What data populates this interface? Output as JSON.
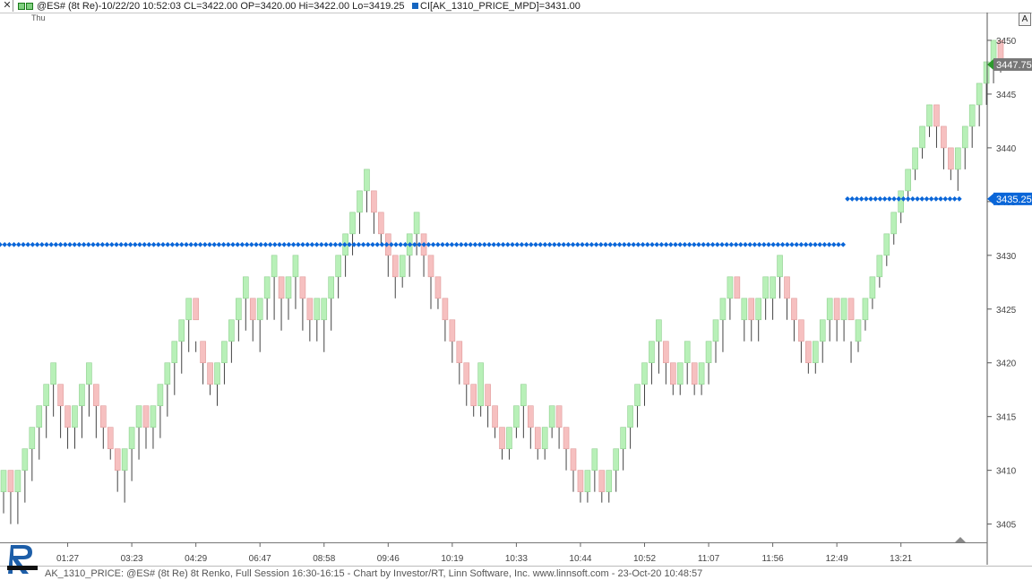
{
  "header": {
    "close_icon": "close-icon",
    "symbol_title": "@ES# (8t Re)-10/22/20 10:52:03 CL=3422.00 OP=3420.00 Hi=3422.00 Lo=3419.25",
    "indicator_title": "CI[AK_1310_PRICE_MPD]=3431.00",
    "indicator_color": "#1565c0",
    "day_label": "Thu",
    "autoscale_button": "A"
  },
  "footer": {
    "text": "AK_1310_PRICE: @ES# (8t Re) 8t Renko, Full Session 16:30-16:15 - Chart by Investor/RT, Linn Software, Inc. www.linnsoft.com - 23-Oct-20 10:48:57"
  },
  "colors": {
    "up": "#b8f0b8",
    "down": "#f6c0c0",
    "wick": "#444444",
    "indicator": "#0a66d8",
    "last_price_bg": "#777777"
  },
  "chart_data": {
    "type": "candlestick",
    "bar_type": "8t Renko",
    "y_ticks": [
      3405,
      3410,
      3415,
      3420,
      3425,
      3430,
      3435,
      3440,
      3445,
      3450
    ],
    "ylim": [
      3403.3,
      3452.5
    ],
    "x_ticks": [
      "01:27",
      "03:23",
      "04:29",
      "06:47",
      "08:58",
      "09:46",
      "10:19",
      "10:33",
      "10:44",
      "10:52",
      "11:07",
      "11:56",
      "12:49",
      "13:21"
    ],
    "last_price_label": "3447.75",
    "indicator_label": "3435.25",
    "ohlc": [
      [
        3408,
        3410,
        3406,
        3410
      ],
      [
        3410,
        3408,
        3405,
        3408
      ],
      [
        3408,
        3410,
        3405,
        3410
      ],
      [
        3410,
        3412,
        3407,
        3412
      ],
      [
        3412,
        3414,
        3409,
        3414
      ],
      [
        3414,
        3416,
        3411,
        3416
      ],
      [
        3416,
        3418,
        3413,
        3418
      ],
      [
        3418,
        3420,
        3415,
        3418
      ],
      [
        3418,
        3416,
        3413,
        3416
      ],
      [
        3416,
        3414,
        3412,
        3414
      ],
      [
        3414,
        3416,
        3412,
        3416
      ],
      [
        3416,
        3418,
        3413,
        3418
      ],
      [
        3418,
        3420,
        3415,
        3418
      ],
      [
        3418,
        3416,
        3413,
        3416
      ],
      [
        3416,
        3414,
        3412,
        3414
      ],
      [
        3414,
        3412,
        3411,
        3412
      ],
      [
        3412,
        3410,
        3408,
        3410
      ],
      [
        3410,
        3412,
        3407,
        3412
      ],
      [
        3412,
        3414,
        3409,
        3414
      ],
      [
        3414,
        3416,
        3411,
        3416
      ],
      [
        3416,
        3414,
        3412,
        3414
      ],
      [
        3414,
        3416,
        3412,
        3416
      ],
      [
        3416,
        3418,
        3413,
        3418
      ],
      [
        3418,
        3420,
        3415,
        3420
      ],
      [
        3420,
        3422,
        3417,
        3422
      ],
      [
        3422,
        3424,
        3419,
        3424
      ],
      [
        3424,
        3426,
        3421,
        3426
      ],
      [
        3426,
        3424,
        3421,
        3422
      ],
      [
        3422,
        3420,
        3418,
        3420
      ],
      [
        3420,
        3418,
        3417,
        3418
      ],
      [
        3418,
        3420,
        3416,
        3420
      ],
      [
        3420,
        3422,
        3418,
        3422
      ],
      [
        3422,
        3424,
        3420,
        3424
      ],
      [
        3424,
        3426,
        3422,
        3426
      ],
      [
        3426,
        3428,
        3423,
        3426
      ],
      [
        3426,
        3424,
        3422,
        3424
      ],
      [
        3424,
        3426,
        3421,
        3426
      ],
      [
        3426,
        3428,
        3424,
        3428
      ],
      [
        3428,
        3430,
        3424,
        3428
      ],
      [
        3428,
        3426,
        3423,
        3426
      ],
      [
        3426,
        3428,
        3424,
        3428
      ],
      [
        3428,
        3430,
        3425,
        3428
      ],
      [
        3428,
        3426,
        3423,
        3426
      ],
      [
        3426,
        3424,
        3422,
        3424
      ],
      [
        3424,
        3426,
        3422,
        3424
      ],
      [
        3424,
        3426,
        3421,
        3426
      ],
      [
        3426,
        3428,
        3423,
        3428
      ],
      [
        3428,
        3430,
        3426,
        3430
      ],
      [
        3430,
        3432,
        3428,
        3432
      ],
      [
        3432,
        3434,
        3430,
        3434
      ],
      [
        3434,
        3436,
        3432,
        3436
      ],
      [
        3436,
        3438,
        3434,
        3436
      ],
      [
        3436,
        3434,
        3432,
        3434
      ],
      [
        3434,
        3432,
        3431,
        3432
      ],
      [
        3432,
        3430,
        3428,
        3430
      ],
      [
        3430,
        3428,
        3426,
        3428
      ],
      [
        3428,
        3430,
        3427,
        3430
      ],
      [
        3430,
        3432,
        3428,
        3432
      ],
      [
        3432,
        3434,
        3430,
        3432
      ],
      [
        3432,
        3430,
        3428,
        3430
      ],
      [
        3430,
        3428,
        3425,
        3428
      ],
      [
        3428,
        3426,
        3425,
        3426
      ],
      [
        3426,
        3424,
        3422,
        3424
      ],
      [
        3424,
        3422,
        3420,
        3422
      ],
      [
        3422,
        3420,
        3418,
        3420
      ],
      [
        3420,
        3418,
        3416,
        3418
      ],
      [
        3418,
        3416,
        3415,
        3416
      ],
      [
        3416,
        3420,
        3415,
        3418
      ],
      [
        3418,
        3416,
        3414,
        3416
      ],
      [
        3416,
        3414,
        3413,
        3414
      ],
      [
        3414,
        3412,
        3411,
        3412
      ],
      [
        3412,
        3414,
        3411,
        3414
      ],
      [
        3414,
        3416,
        3413,
        3416
      ],
      [
        3416,
        3418,
        3413,
        3416
      ],
      [
        3416,
        3414,
        3412,
        3414
      ],
      [
        3414,
        3412,
        3411,
        3412
      ],
      [
        3412,
        3414,
        3411,
        3414
      ],
      [
        3414,
        3416,
        3413,
        3416
      ],
      [
        3416,
        3414,
        3412,
        3414
      ],
      [
        3414,
        3412,
        3410,
        3412
      ],
      [
        3412,
        3410,
        3408,
        3410
      ],
      [
        3410,
        3408,
        3407,
        3408
      ],
      [
        3408,
        3410,
        3407,
        3410
      ],
      [
        3410,
        3412,
        3408,
        3410
      ],
      [
        3410,
        3408,
        3407,
        3408
      ],
      [
        3408,
        3410,
        3407,
        3410
      ],
      [
        3410,
        3412,
        3408,
        3412
      ],
      [
        3412,
        3414,
        3410,
        3414
      ],
      [
        3414,
        3416,
        3412,
        3416
      ],
      [
        3416,
        3418,
        3414,
        3418
      ],
      [
        3418,
        3420,
        3416,
        3420
      ],
      [
        3420,
        3422,
        3418,
        3422
      ],
      [
        3422,
        3424,
        3419,
        3422
      ],
      [
        3422,
        3420,
        3418,
        3420
      ],
      [
        3420,
        3418,
        3417,
        3418
      ],
      [
        3418,
        3420,
        3417,
        3420
      ],
      [
        3420,
        3422,
        3418,
        3420
      ],
      [
        3420,
        3418,
        3417,
        3418
      ],
      [
        3418,
        3420,
        3417,
        3420
      ],
      [
        3420,
        3422,
        3418,
        3422
      ],
      [
        3422,
        3424,
        3420,
        3424
      ],
      [
        3424,
        3426,
        3421,
        3426
      ],
      [
        3426,
        3428,
        3424,
        3428
      ],
      [
        3428,
        3426,
        3424,
        3424
      ],
      [
        3424,
        3426,
        3422,
        3426
      ],
      [
        3426,
        3424,
        3422,
        3424
      ],
      [
        3424,
        3426,
        3422,
        3426
      ],
      [
        3426,
        3428,
        3424,
        3426
      ],
      [
        3426,
        3428,
        3424,
        3428
      ],
      [
        3428,
        3430,
        3426,
        3428
      ],
      [
        3428,
        3426,
        3424,
        3426
      ],
      [
        3426,
        3424,
        3422,
        3424
      ],
      [
        3424,
        3422,
        3420,
        3422
      ],
      [
        3422,
        3420,
        3419,
        3420
      ],
      [
        3420,
        3422,
        3419,
        3422
      ],
      [
        3422,
        3424,
        3420,
        3424
      ],
      [
        3424,
        3426,
        3422,
        3426
      ],
      [
        3426,
        3424,
        3422,
        3424
      ],
      [
        3424,
        3426,
        3422,
        3426
      ],
      [
        3426,
        3424,
        3420,
        3422
      ],
      [
        3422,
        3424,
        3421,
        3424
      ],
      [
        3424,
        3426,
        3423,
        3426
      ],
      [
        3426,
        3428,
        3425,
        3428
      ],
      [
        3428,
        3430,
        3427,
        3430
      ],
      [
        3430,
        3432,
        3429,
        3432
      ],
      [
        3432,
        3434,
        3431,
        3434
      ],
      [
        3434,
        3436,
        3433,
        3436
      ],
      [
        3436,
        3438,
        3435,
        3438
      ],
      [
        3438,
        3440,
        3437,
        3440
      ],
      [
        3440,
        3442,
        3439,
        3442
      ],
      [
        3442,
        3444,
        3441,
        3444
      ],
      [
        3444,
        3442,
        3440,
        3442
      ],
      [
        3442,
        3440,
        3438,
        3440
      ],
      [
        3440,
        3438,
        3437,
        3438
      ],
      [
        3438,
        3440,
        3436,
        3440
      ],
      [
        3440,
        3442,
        3438,
        3442
      ],
      [
        3442,
        3444,
        3440,
        3444
      ],
      [
        3444,
        3446,
        3442,
        3446
      ],
      [
        3446,
        3448,
        3444,
        3448
      ],
      [
        3448,
        3450,
        3446,
        3450
      ],
      [
        3450,
        3448,
        3447,
        3448
      ]
    ],
    "indicator_series": [
      {
        "from_bar": 0,
        "to_bar": 118,
        "value": 3431.0
      },
      {
        "from_bar": 119,
        "to_bar": 134,
        "value": 3435.25
      }
    ]
  }
}
